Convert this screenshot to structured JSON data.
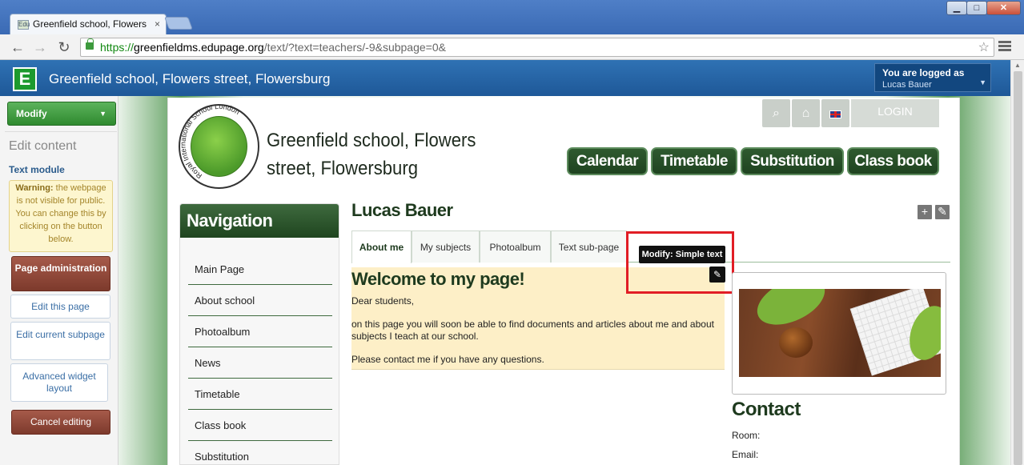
{
  "browser": {
    "tab_title": "Greenfield school, Flowers st",
    "tab_favicon_text": "Edu",
    "tab_close": "×",
    "url_proto": "https://",
    "url_host": "greenfieldms.edupage.org",
    "url_path": "/text/?text=teachers/-9&subpage=0&",
    "window_minimize": "▁",
    "window_maximize": "□",
    "window_close": "✕"
  },
  "edubar": {
    "logo_letter": "E",
    "title": "Greenfield school, Flowers street, Flowersburg",
    "logged_as_label": "You are logged as",
    "user_name": "Lucas Bauer"
  },
  "edit_panel": {
    "modify_label": "Modify",
    "edit_content_label": "Edit content",
    "text_module_label": "Text module",
    "warning_bold": "Warning:",
    "warning_text": "the webpage is not visible for public. You can change this by clicking on the button below.",
    "page_admin_label": "Page administration",
    "edit_this_page_label": "Edit this page",
    "edit_current_subpage_label": "Edit current subpage",
    "advanced_widget_layout_label": "Advanced widget layout",
    "cancel_editing_label": "Cancel editing"
  },
  "site": {
    "school_name": "Greenfield school, Flowers street, Flowersburg",
    "logo_ring_text": "Royal International School London",
    "login_label": "LOGIN",
    "main_nav": [
      "Calendar",
      "Timetable",
      "Substitution",
      "Class book"
    ]
  },
  "navigation": {
    "title": "Navigation",
    "items": [
      "Main Page",
      "About school",
      "Photoalbum",
      "News",
      "Timetable",
      "Class book",
      "Substitution"
    ]
  },
  "content": {
    "heading": "Lucas Bauer",
    "tabs": [
      "About me",
      "My subjects",
      "Photoalbum",
      "Text sub-page"
    ],
    "tooltip": "Modify: Simple text",
    "welcome_title": "Welcome to my page!",
    "paragraphs": [
      "Dear students,",
      "on this page you will soon be able to find documents and articles about me and about subjects I teach at our school.",
      "Please contact me if you have any questions."
    ],
    "contact_title": "Contact",
    "contact_room_label": "Room:",
    "contact_email_label": "Email:"
  },
  "colors": {
    "highlight": "#e11d25",
    "nav_green": "#1f4320",
    "text_widget_bg": "#fdefc7"
  }
}
